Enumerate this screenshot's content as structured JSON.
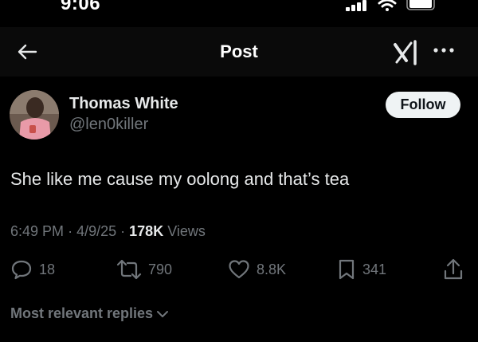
{
  "status_bar": {
    "time": "9:06"
  },
  "header": {
    "title": "Post"
  },
  "post": {
    "author": {
      "name": "Thomas White",
      "handle": "@len0killer"
    },
    "follow_label": "Follow",
    "text": "She like me cause my oolong and that’s tea",
    "meta": {
      "time": "6:49 PM",
      "date": "4/9/25",
      "separator": "·",
      "views_count": "178K",
      "views_label": "Views"
    }
  },
  "actions": {
    "replies": "18",
    "reposts": "790",
    "likes": "8.8K",
    "bookmarks": "341"
  },
  "replies_filter": {
    "label": "Most relevant replies"
  },
  "colors": {
    "background": "#000000",
    "text": "#e7e9ea",
    "secondary": "#71767b",
    "follow_bg": "#eff3f4"
  },
  "icons": [
    "back-arrow-icon",
    "grok-icon",
    "more-icon",
    "reply-icon",
    "repost-icon",
    "like-icon",
    "bookmark-icon",
    "share-icon",
    "chevron-down-icon"
  ]
}
